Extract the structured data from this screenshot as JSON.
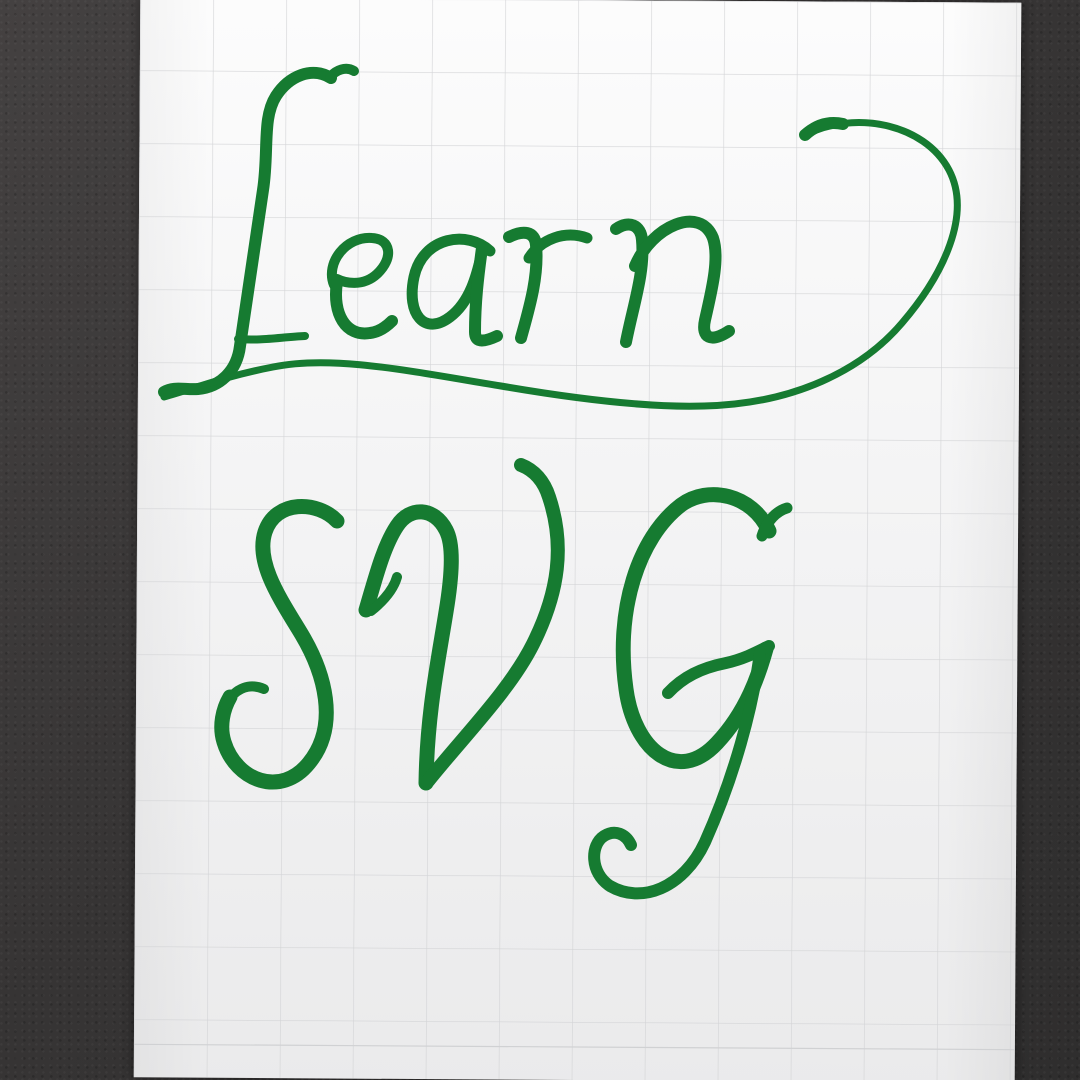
{
  "card_lettering": "Learn SVG",
  "colors": {
    "desk": "#3a3838",
    "paper": "#f3f3f4",
    "grid": "#cfd0d2",
    "ink": "#167b31",
    "ink_dark": "#0d5a22"
  }
}
